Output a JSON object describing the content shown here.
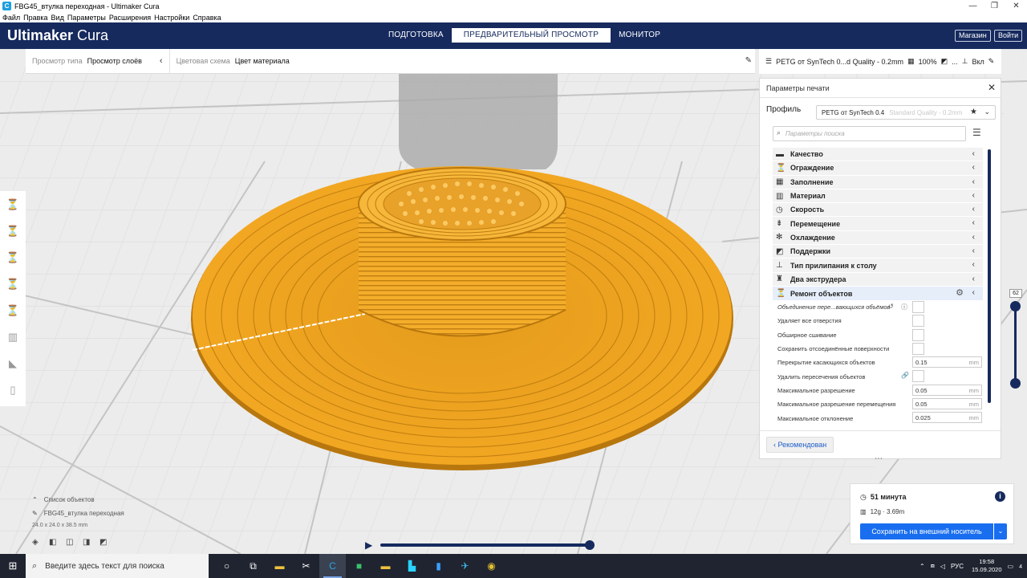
{
  "window": {
    "title": "FBG45_втулка переходная - Ultimaker Cura",
    "controls": [
      "—",
      "❐",
      "✕"
    ]
  },
  "menu": [
    "Файл",
    "Правка",
    "Вид",
    "Параметры",
    "Расширения",
    "Настройки",
    "Справка"
  ],
  "header": {
    "logo_bold": "Ultimaker",
    "logo_light": " Cura",
    "stages": [
      "ПОДГОТОВКА",
      "ПРЕДВАРИТЕЛЬНЫЙ ПРОСМОТР",
      "МОНИТОР"
    ],
    "active_stage": 1,
    "marketplace": "Магазин",
    "signin": "Войти"
  },
  "viewbar": {
    "view_type_label": "Просмотр типа",
    "view_type_value": "Просмотр слоёв",
    "color_scheme_label": "Цветовая схема",
    "color_scheme_value": "Цвет материала"
  },
  "profilebar": {
    "profile": "PETG от SynTech 0...d Quality - 0.2mm",
    "infill": "100%",
    "support": "...",
    "adhesion": "Вкл"
  },
  "panel": {
    "title": "Параметры печати",
    "profile_label": "Профиль",
    "profile_value": "PETG от SynTech 0.4",
    "profile_sub": "Standard Quality - 0.2mm",
    "search_placeholder": "Параметры поиска",
    "categories": [
      {
        "label": "Качество",
        "icon": "quality-icon",
        "glyph": "▬"
      },
      {
        "label": "Ограждение",
        "icon": "shell-icon",
        "glyph": "⏳"
      },
      {
        "label": "Заполнение",
        "icon": "infill-icon",
        "glyph": "▦"
      },
      {
        "label": "Материал",
        "icon": "material-icon",
        "glyph": "▥"
      },
      {
        "label": "Скорость",
        "icon": "speed-icon",
        "glyph": "◷"
      },
      {
        "label": "Перемещение",
        "icon": "travel-icon",
        "glyph": "⇟"
      },
      {
        "label": "Охлаждение",
        "icon": "cooling-icon",
        "glyph": "✻"
      },
      {
        "label": "Поддержки",
        "icon": "support-icon",
        "glyph": "◩"
      },
      {
        "label": "Тип прилипания к столу",
        "icon": "adhesion-icon",
        "glyph": "⊥"
      },
      {
        "label": "Два экструдера",
        "icon": "dual-extruder-icon",
        "glyph": "♜"
      },
      {
        "label": "Ремонт объектов",
        "icon": "mesh-fixes-icon",
        "glyph": "⏳"
      }
    ],
    "settings": [
      {
        "label": "Объединение пере...вающихся объёмов",
        "type": "check",
        "italic": true
      },
      {
        "label": "Удаляет все отверстия",
        "type": "check"
      },
      {
        "label": "Обширное сшивание",
        "type": "check"
      },
      {
        "label": "Сохранить отсоединённые поверхности",
        "type": "check"
      },
      {
        "label": "Перекрытие касающихся объектов",
        "type": "number",
        "value": "0.15",
        "unit": "mm"
      },
      {
        "label": "Удалить пересечения объектов",
        "type": "check",
        "link": true
      },
      {
        "label": "Максимальное разрешение",
        "type": "number",
        "value": "0.05",
        "unit": "mm"
      },
      {
        "label": "Максимальное разрешение перемещения",
        "type": "number",
        "value": "0.05",
        "unit": "mm"
      },
      {
        "label": "Максимальное отклонение",
        "type": "number",
        "value": "0.025",
        "unit": "mm"
      }
    ],
    "recommended_btn": "Рекомендован"
  },
  "layer_slider": {
    "value": "62"
  },
  "objects": {
    "list_label": "Список объектов",
    "name": "FBG45_втулка переходная",
    "dims": "24.0 x 24.0 x 38.5 mm"
  },
  "estimate": {
    "time": "51 минута",
    "material": "12g · 3.69m",
    "save": "Сохранить на внешний носитель"
  },
  "taskbar": {
    "search": "Введите здесь текст для поиска",
    "lang": "РУС",
    "time": "19:58",
    "date": "15.09.2020",
    "notification_count": "4"
  },
  "colors": {
    "header_bg": "#162a5e",
    "accent_blue": "#196ef0",
    "model_orange": "#f2a722"
  }
}
